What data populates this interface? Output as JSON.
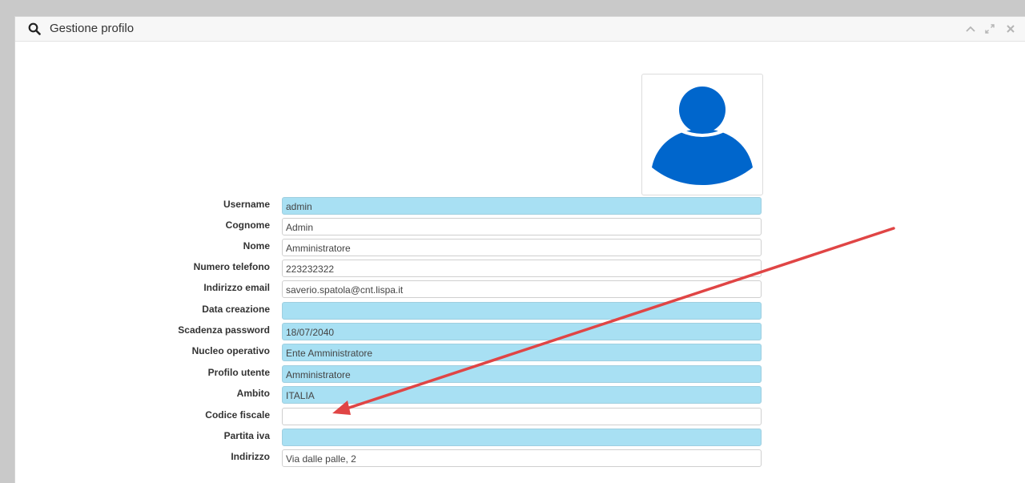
{
  "panel": {
    "title": "Gestione profilo",
    "header_icons": [
      "search-icon",
      "chevron-up-icon",
      "expand-icon",
      "close-icon"
    ]
  },
  "avatar": {
    "icon": "user-icon",
    "color": "#0066cc"
  },
  "form": {
    "username": {
      "label": "Username",
      "value": "admin"
    },
    "cognome": {
      "label": "Cognome",
      "value": "Admin"
    },
    "nome": {
      "label": "Nome",
      "value": "Amministratore"
    },
    "telefono": {
      "label": "Numero telefono",
      "value": "223232322"
    },
    "email": {
      "label": "Indirizzo email",
      "value": "saverio.spatola@cnt.lispa.it"
    },
    "data_creazione": {
      "label": "Data creazione",
      "value": ""
    },
    "scadenza": {
      "label": "Scadenza password",
      "value": "18/07/2040"
    },
    "nucleo": {
      "label": "Nucleo operativo",
      "value": "Ente Amministratore"
    },
    "profilo": {
      "label": "Profilo utente",
      "value": "Amministratore"
    },
    "ambito": {
      "label": "Ambito",
      "value": "ITALIA"
    },
    "codice_fiscale": {
      "label": "Codice fiscale",
      "value": ""
    },
    "partita_iva": {
      "label": "Partita iva",
      "value": ""
    },
    "indirizzo": {
      "label": "Indirizzo",
      "value": "Via dalle palle, 2"
    }
  },
  "colors": {
    "readonly_bg": "#a8e0f3",
    "annotation_arrow": "#e04545"
  }
}
